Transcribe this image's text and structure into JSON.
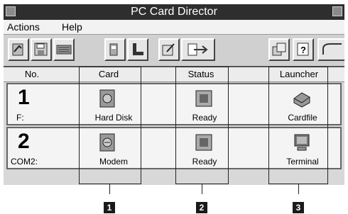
{
  "window": {
    "title": "PC Card Director"
  },
  "menu": {
    "items": [
      "Actions",
      "Help"
    ]
  },
  "toolbar": {
    "buttons": [
      "card-info-icon",
      "save-icon",
      "keyboard-icon",
      "card-slot-icon",
      "signal-icon",
      "edit-icon",
      "redirect-icon",
      "cards-icon",
      "help-icon",
      "card-eject-icon"
    ]
  },
  "columns": {
    "no": "No.",
    "card": "Card",
    "status": "Status",
    "launcher": "Launcher"
  },
  "rows": [
    {
      "number": "1",
      "drive": "F:",
      "card": "Hard Disk",
      "card_icon": "hard-disk-card-icon",
      "status": "Ready",
      "status_icon": "ready-icon",
      "launcher": "Cardfile",
      "launcher_icon": "cardfile-icon"
    },
    {
      "number": "2",
      "drive": "COM2:",
      "card": "Modem",
      "card_icon": "modem-card-icon",
      "status": "Ready",
      "status_icon": "ready-icon",
      "launcher": "Terminal",
      "launcher_icon": "terminal-icon"
    }
  ],
  "callouts": [
    "1",
    "2",
    "3"
  ]
}
